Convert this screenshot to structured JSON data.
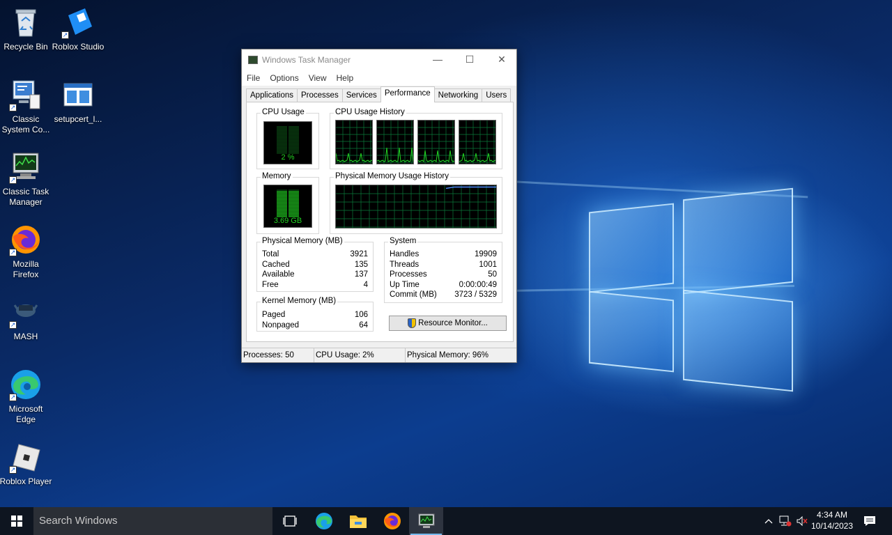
{
  "desktop": {
    "icons": [
      {
        "label": "Recycle Bin",
        "icon": "recycle-bin-icon"
      },
      {
        "label": "Roblox Studio",
        "icon": "roblox-studio-icon"
      },
      {
        "label": "Classic System Co...",
        "icon": "control-panel-icon"
      },
      {
        "label": "setupcert_l...",
        "icon": "document-icon"
      },
      {
        "label": "Classic Task Manager",
        "icon": "task-manager-icon"
      },
      {
        "label": "Mozilla Firefox",
        "icon": "firefox-icon"
      },
      {
        "label": "MASH",
        "icon": "mash-icon"
      },
      {
        "label": "Microsoft Edge",
        "icon": "edge-icon"
      },
      {
        "label": "Roblox Player",
        "icon": "roblox-player-icon"
      }
    ]
  },
  "taskmgr": {
    "title": "Windows Task Manager",
    "menu": [
      "File",
      "Options",
      "View",
      "Help"
    ],
    "tabs": [
      "Applications",
      "Processes",
      "Services",
      "Performance",
      "Networking",
      "Users"
    ],
    "active_tab": "Performance",
    "cpu_usage_label": "CPU Usage",
    "cpu_value": "2 %",
    "cpu_history_label": "CPU Usage History",
    "memory_label": "Memory",
    "memory_value": "3.69 GB",
    "memory_history_label": "Physical Memory Usage History",
    "physical_memory": {
      "title": "Physical Memory (MB)",
      "rows": [
        {
          "label": "Total",
          "value": "3921"
        },
        {
          "label": "Cached",
          "value": "135"
        },
        {
          "label": "Available",
          "value": "137"
        },
        {
          "label": "Free",
          "value": "4"
        }
      ]
    },
    "kernel_memory": {
      "title": "Kernel Memory (MB)",
      "rows": [
        {
          "label": "Paged",
          "value": "106"
        },
        {
          "label": "Nonpaged",
          "value": "64"
        }
      ]
    },
    "system": {
      "title": "System",
      "rows": [
        {
          "label": "Handles",
          "value": "19909"
        },
        {
          "label": "Threads",
          "value": "1001"
        },
        {
          "label": "Processes",
          "value": "50"
        },
        {
          "label": "Up Time",
          "value": "0:00:00:49"
        },
        {
          "label": "Commit (MB)",
          "value": "3723 / 5329"
        }
      ]
    },
    "resource_monitor_button": "Resource Monitor...",
    "status": {
      "processes": "Processes: 50",
      "cpu": "CPU Usage: 2%",
      "memory": "Physical Memory: 96%"
    },
    "cpu_usage_fraction": 0.02,
    "memory_usage_fraction": 0.96
  },
  "taskbar": {
    "search_placeholder": "Search Windows",
    "pinned": [
      "task-view-icon",
      "edge-icon",
      "file-explorer-icon",
      "firefox-icon",
      "task-manager-icon"
    ],
    "time": "4:34 AM",
    "date": "10/14/2023"
  },
  "colors": {
    "graph_green": "#22d422",
    "grid": "#0a7a3a",
    "memory_line": "#4f8cff",
    "taskbar": "#0e1520"
  }
}
